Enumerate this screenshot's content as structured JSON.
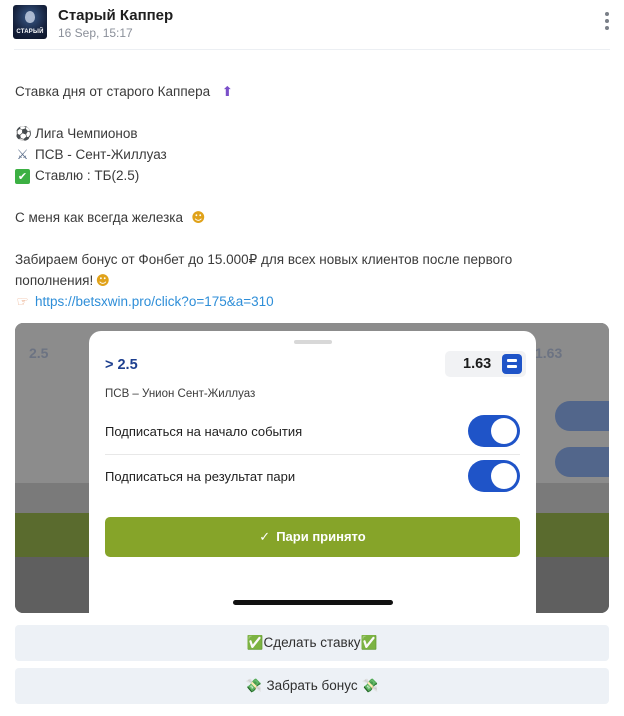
{
  "post": {
    "channel_name": "Старый Каппер",
    "timestamp": "16 Sep, 15:17",
    "avatar_text": "СТАРЫЙ"
  },
  "message": {
    "headline": "Ставка дня от старого Каппера",
    "league": "Лига Чемпионов",
    "match": "ПСВ - Сент-Жиллуаз",
    "bet": "Ставлю : ТБ(2.5)",
    "note": "С меня как всегда железка",
    "promo_line1": "Забираем бонус от Фонбет до 15.000₽ для всех новых клиентов после первого",
    "promo_line2": "пополнения!",
    "link": "https://betsxwin.pro/click?o=175&a=310"
  },
  "icons": {
    "top": "top-arrow-icon",
    "league": "soccer-ball-icon",
    "match": "crossed-swords-icon",
    "bet": "check-mark-icon",
    "note": "money-mouth-face-icon",
    "pointer": "pointing-hand-icon"
  },
  "bet_slip": {
    "selection": "> 2.5",
    "odds": "1.63",
    "match_name": "ПСВ – Унион Сент-Жиллуаз",
    "toggle_start_label": "Подписаться на начало события",
    "toggle_start_on": true,
    "toggle_result_label": "Подписаться на результат пари",
    "toggle_result_on": true,
    "accept_label": "Пари принято",
    "colors": {
      "accent_blue": "#1f54c8",
      "accept_green": "#86a429"
    }
  },
  "buttons": {
    "make_bet": "Сделать ставку",
    "get_bonus": "Забрать бонус"
  }
}
